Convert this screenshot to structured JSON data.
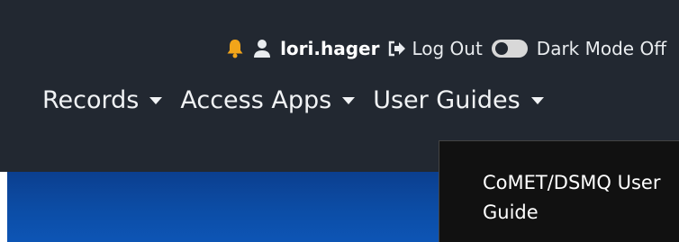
{
  "user_bar": {
    "bell_icon": "bell-icon",
    "user_icon": "user-icon",
    "username": "lori.hager",
    "logout_icon": "sign-out-icon",
    "logout_label": "Log Out",
    "dark_mode_label": "Dark Mode Off"
  },
  "menu": {
    "items": [
      {
        "label": "Records"
      },
      {
        "label": "Access Apps"
      },
      {
        "label": "User Guides"
      }
    ]
  },
  "dropdown": {
    "items": [
      {
        "label": "CoMET/DSMQ User Guide"
      }
    ]
  },
  "colors": {
    "navbar_bg": "#222831",
    "bell": "#f2a51a",
    "blue_band": "#0c4da6",
    "dropdown_bg": "#111111"
  }
}
